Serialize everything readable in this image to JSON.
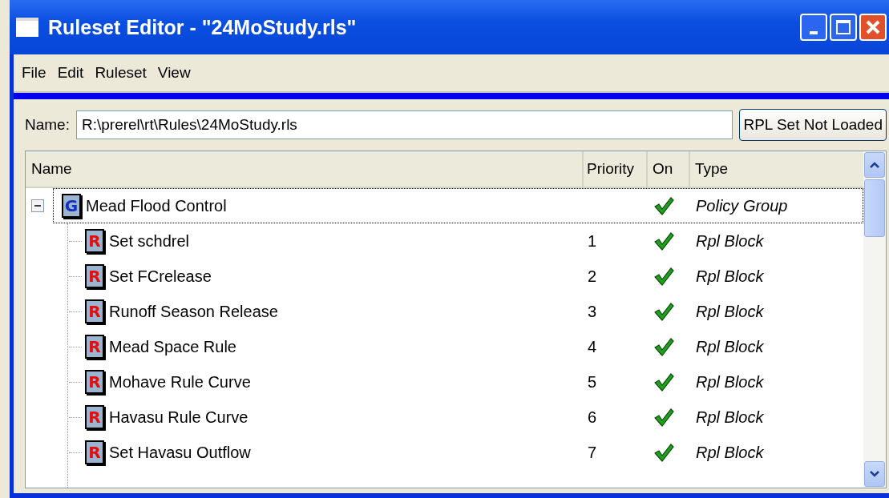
{
  "window": {
    "title": "Ruleset Editor - \"24MoStudy.rls\""
  },
  "menu": [
    "File",
    "Edit",
    "Ruleset",
    "View"
  ],
  "name_field": {
    "label": "Name:",
    "value": "R:\\prerel\\rt\\Rules\\24MoStudy.rls"
  },
  "status_button": "RPL Set Not Loaded",
  "tree": {
    "columns": [
      "Name",
      "Priority",
      "On",
      "Type"
    ],
    "rows": [
      {
        "kind": "group",
        "icon_letter": "G",
        "name": "Mead Flood Control",
        "on": true,
        "type": "Policy Group",
        "expanded": true,
        "focused": true,
        "children": [
          {
            "kind": "rule",
            "icon_letter": "R",
            "name": "Set schdrel",
            "priority": "1",
            "on": true,
            "type": "Rpl Block",
            "focused": false
          },
          {
            "kind": "rule",
            "icon_letter": "R",
            "name": "Set FCrelease",
            "priority": "2",
            "on": true,
            "type": "Rpl Block",
            "focused": false
          },
          {
            "kind": "rule",
            "icon_letter": "R",
            "name": "Runoff Season Release",
            "priority": "3",
            "on": true,
            "type": "Rpl Block",
            "focused": false
          },
          {
            "kind": "rule",
            "icon_letter": "R",
            "name": "Mead Space Rule",
            "priority": "4",
            "on": true,
            "type": "Rpl Block",
            "focused": false
          },
          {
            "kind": "rule",
            "icon_letter": "R",
            "name": "Mohave Rule Curve",
            "priority": "5",
            "on": true,
            "type": "Rpl Block",
            "focused": false
          },
          {
            "kind": "rule",
            "icon_letter": "R",
            "name": "Havasu Rule Curve",
            "priority": "6",
            "on": true,
            "type": "Rpl Block",
            "focused": false
          },
          {
            "kind": "rule",
            "icon_letter": "R",
            "name": "Set Havasu Outflow",
            "priority": "7",
            "on": true,
            "type": "Rpl Block",
            "focused": false
          }
        ]
      }
    ]
  }
}
